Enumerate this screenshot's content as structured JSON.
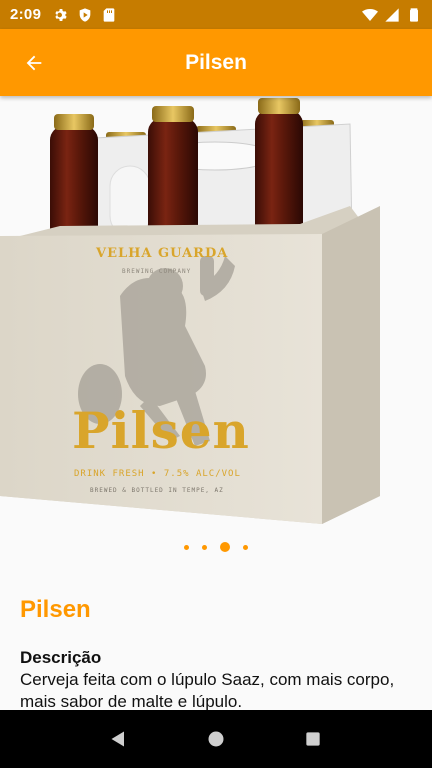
{
  "status_bar": {
    "time": "2:09",
    "icons": [
      "gear-icon",
      "shield-play-icon",
      "sd-card-icon",
      "wifi-icon",
      "signal-icon",
      "battery-icon"
    ]
  },
  "app_bar": {
    "title": "Pilsen",
    "back_icon": "arrow-left-icon"
  },
  "carousel": {
    "product_image": {
      "brand": "VELHA GUARDA",
      "subbrand": "BREWING COMPANY",
      "name": "Pilsen",
      "tagline": "DRINK FRESH • 7.5% ALC/VOL",
      "origin": "BREWED & BOTTLED IN TEMPE, AZ"
    },
    "page_count": 4,
    "active_page": 3
  },
  "product": {
    "title": "Pilsen",
    "description_label": "Descrição",
    "description": "Cerveja feita com o lúpulo Saaz, com mais corpo, mais sabor de malte e lúpulo."
  },
  "colors": {
    "accent": "#ff9800",
    "status_bar": "#c67c00",
    "label_gold": "#d9a52b"
  },
  "nav_bar": {
    "icons": [
      "back-triangle-icon",
      "home-circle-icon",
      "recents-square-icon"
    ]
  }
}
